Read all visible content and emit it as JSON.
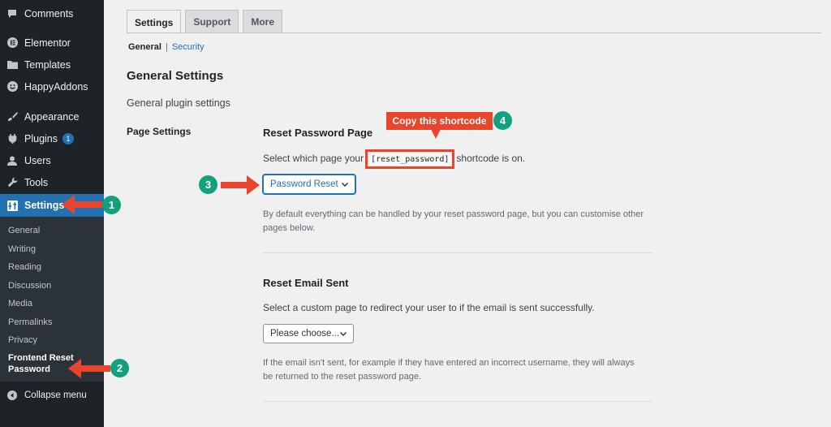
{
  "sidebar": {
    "items": [
      {
        "label": "Comments",
        "icon": "comments-icon"
      },
      {
        "label": "Elementor",
        "icon": "elementor-icon"
      },
      {
        "label": "Templates",
        "icon": "folder-icon"
      },
      {
        "label": "HappyAddons",
        "icon": "happyaddons-icon"
      },
      {
        "label": "Appearance",
        "icon": "brush-icon"
      },
      {
        "label": "Plugins",
        "icon": "plug-icon",
        "badge": "1"
      },
      {
        "label": "Users",
        "icon": "user-icon"
      },
      {
        "label": "Tools",
        "icon": "wrench-icon"
      },
      {
        "label": "Settings",
        "icon": "settings-icon"
      }
    ],
    "submenu": [
      "General",
      "Writing",
      "Reading",
      "Discussion",
      "Media",
      "Permalinks",
      "Privacy",
      "Frontend Reset Password"
    ],
    "collapse_label": "Collapse menu"
  },
  "tabs": [
    "Settings",
    "Support",
    "More"
  ],
  "subnav": {
    "current": "General",
    "separator": "|",
    "link": "Security"
  },
  "main": {
    "title": "General Settings",
    "description": "General plugin settings",
    "section_label": "Page Settings"
  },
  "reset_password": {
    "title": "Reset Password Page",
    "text_before": "Select which page your",
    "shortcode": "[reset_password]",
    "text_after": "shortcode is on.",
    "select_value": "Password Reset",
    "help": "By default everything can be handled by your reset password page, but you can customise other pages below."
  },
  "reset_email": {
    "title": "Reset Email Sent",
    "text": "Select a custom page to redirect your user to if the email is sent successfully.",
    "select_value": "Please choose...",
    "help": "If the email isn't sent, for example if they have entered an incorrect username, they will always be returned to the reset password page."
  },
  "annotations": {
    "callout": "Copy this shortcode",
    "steps": [
      "1",
      "2",
      "3",
      "4"
    ],
    "arrow_color": "#e8452c",
    "step_color": "#12a07d"
  }
}
